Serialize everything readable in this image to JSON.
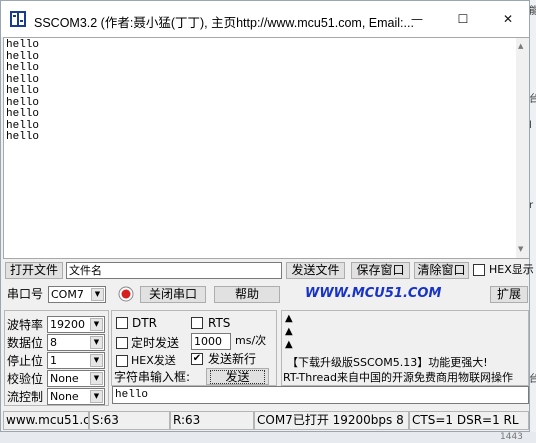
{
  "window": {
    "title": "SSCOM3.2 (作者:聂小猛(丁丁), 主页http://www.mcu51.com,  Email:...",
    "minimize_glyph": "—",
    "maximize_glyph": "☐",
    "close_glyph": "✕"
  },
  "receive": {
    "text": "hello\nhello\nhello\nhello\nhello\nhello\nhello\nhello\nhello"
  },
  "file_row": {
    "open_file": "打开文件",
    "file_name": "文件名",
    "send_file": "发送文件",
    "save_window": "保存窗口",
    "clear_window": "清除窗口",
    "hex_display": "HEX显示"
  },
  "port_row": {
    "port_label": "串口号",
    "port_value": "COM7",
    "close_port": "关闭串口",
    "help": "帮助",
    "website": "WWW.MCU51.COM",
    "expand": "扩展"
  },
  "settings": {
    "baud_label": "波特率",
    "baud_value": "19200",
    "databits_label": "数据位",
    "databits_value": "8",
    "stopbits_label": "停止位",
    "stopbits_value": "1",
    "parity_label": "校验位",
    "parity_value": "None",
    "flow_label": "流控制",
    "flow_value": "None"
  },
  "send_options": {
    "dtr": "DTR",
    "rts": "RTS",
    "timed_send": "定时发送",
    "interval_value": "1000",
    "interval_unit": "ms/次",
    "hex_send": "HEX发送",
    "send_newline": "发送新行",
    "string_input": "字符串输入框:",
    "send_button": "发送",
    "send_text": "hello"
  },
  "ad": {
    "line1": "【下载升级版SSCOM5.13】功能更强大!",
    "line2": "RT-Thread来自中国的开源免费商用物联网操作"
  },
  "status": {
    "site": "www.mcu51.cor",
    "sent": "S:63",
    "received": "R:63",
    "port_state": "COM7已打开  19200bps  8",
    "lines": "CTS=1 DSR=1 RL"
  },
  "background": {
    "bottom_text": "1443"
  }
}
